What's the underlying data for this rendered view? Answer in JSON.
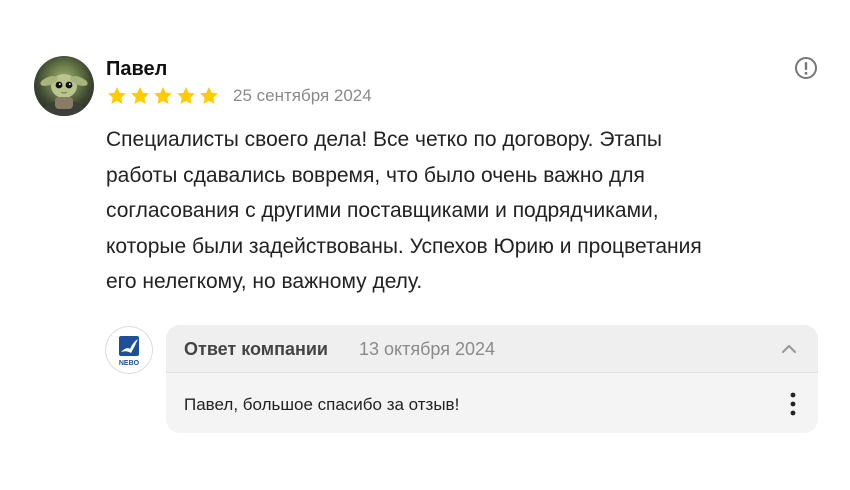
{
  "review": {
    "author_name": "Павел",
    "rating": 5,
    "rating_max": 5,
    "date": "25 сентября 2024",
    "text": "Специалисты своего дела! Все четко по договору. Этапы работы сдавались вовремя, что было очень важно для согласования с другими поставщиками и подрядчиками, которые были задействованы. Успехов Юрию и процветания его нелегкому, но важному делу.",
    "text_lines": [
      "Специалисты своего дела! Все четко по договору. Этапы",
      "работы сдавались вовремя, что было очень важно для",
      "согласования с другими поставщиками и подрядчиками,",
      "которые были задействованы. Успехов Юрию и процветания",
      "его нелегкому, но важному делу."
    ],
    "icons": {
      "avatar": "user-avatar-photo",
      "star": "star-icon",
      "report": "info-circle-icon"
    }
  },
  "company_reply": {
    "title": "Ответ компании",
    "date": "13 октября 2024",
    "text": "Павел, большое спасибо за отзыв!",
    "logo_text": "NEBO",
    "icons": {
      "logo": "company-logo-bird",
      "collapse": "chevron-up-icon",
      "more": "more-vertical-icon"
    }
  },
  "colors": {
    "star": "#ffcc00",
    "secondary_text": "#8a8a8a",
    "reply_background": "#f4f4f4",
    "logo_blue": "#1e4f9a"
  }
}
